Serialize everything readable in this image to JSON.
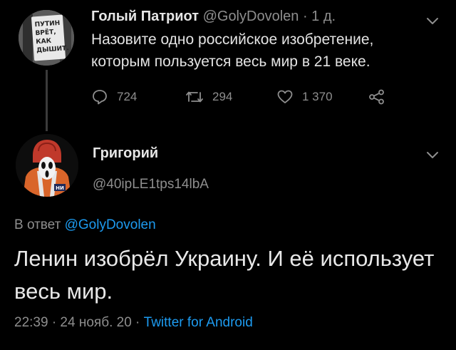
{
  "tweet1": {
    "author_name": "Голый Патриот",
    "handle": "@GolyDovolen",
    "time": "· 1 д.",
    "avatar_sign": [
      "ПУТИН",
      "ВРЁТ,",
      "КАК",
      "ДЫШИТ."
    ],
    "text": "Назовите одно российское изобретение, которым пользуется весь мир в 21 веке.",
    "reply_count": "724",
    "retweet_count": "294",
    "like_count": "1 370",
    "icons": [
      "reply-icon",
      "retweet-icon",
      "like-icon",
      "share-icon",
      "chevron-down-icon"
    ]
  },
  "tweet2": {
    "author_name": "Григорий",
    "handle": "@40ipLE1tps14lbA",
    "reply_prefix": "В ответ",
    "reply_to": "@GolyDovolen",
    "text": "Ленин изобрёл Украину. И её использует весь мир.",
    "timestamp": "22:39 · 24 нояб. 20 ·",
    "source": "Twitter for Android",
    "avatar_badge": "НИ"
  },
  "colors": {
    "background": "#000000",
    "text_primary": "#e3e3e3",
    "text_secondary": "#8e8e8e",
    "link": "#1d9bf0"
  }
}
